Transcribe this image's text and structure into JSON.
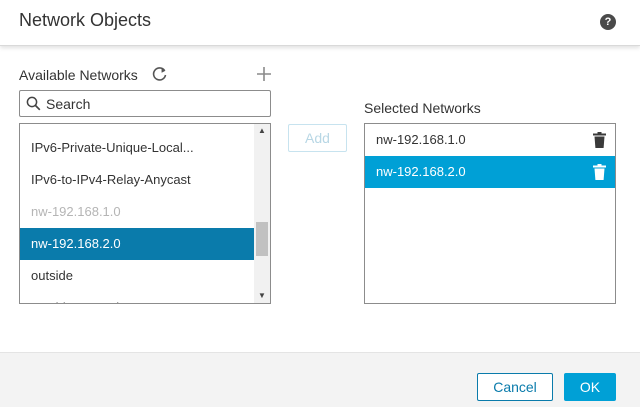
{
  "header": {
    "title": "Network Objects",
    "help_glyph": "?",
    "help_icon": "help-icon"
  },
  "available": {
    "label": "Available Networks",
    "refresh_icon": "refresh-icon",
    "add_icon": "plus-icon",
    "search": {
      "placeholder": "Search",
      "value": ""
    },
    "items": [
      {
        "label": "IPv6-Private-Unique-Local...",
        "state": "normal"
      },
      {
        "label": "IPv6-to-IPv4-Relay-Anycast",
        "state": "normal"
      },
      {
        "label": "nw-192.168.1.0",
        "state": "disabled"
      },
      {
        "label": "nw-192.168.2.0",
        "state": "selected"
      },
      {
        "label": "outside",
        "state": "normal"
      },
      {
        "label": "outside-network",
        "state": "normal"
      }
    ],
    "scroll_up_glyph": "▲",
    "scroll_down_glyph": "▼"
  },
  "add_button": {
    "label": "Add",
    "enabled": false
  },
  "selected": {
    "label": "Selected Networks",
    "items": [
      {
        "label": "nw-192.168.1.0",
        "state": "normal"
      },
      {
        "label": "nw-192.168.2.0",
        "state": "selected"
      }
    ]
  },
  "footer": {
    "cancel_label": "Cancel",
    "ok_label": "OK"
  },
  "colors": {
    "accent": "#00a0d6",
    "accent_dark": "#0a7bab",
    "disabled_text": "#b5b5b5"
  }
}
